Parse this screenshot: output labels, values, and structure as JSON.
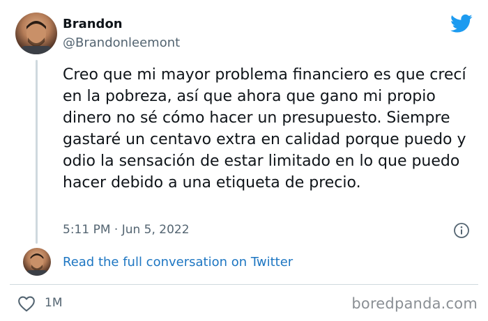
{
  "author": {
    "name": "Brandon",
    "handle": "@Brandonleemont"
  },
  "tweet": {
    "text": "Creo que mi mayor problema financiero es que crecí en la pobreza, así que ahora que gano mi propio dinero no sé cómo hacer un presupuesto. Siempre gastaré un centavo extra en calidad porque puedo y odio la sensación de estar limitado en lo que puedo hacer debido a una etiqueta de precio.",
    "timestamp": "5:11 PM · Jun 5, 2022"
  },
  "conversation_link": "Read the full conversation on Twitter",
  "engagement": {
    "likes": "1M"
  },
  "watermark": "boredpanda.com",
  "icons": [
    "twitter-bird-icon",
    "info-icon",
    "heart-icon"
  ],
  "colors": {
    "brand_blue": "#1d9bf0",
    "link_blue": "#1d76c2",
    "muted_text": "#536471"
  }
}
